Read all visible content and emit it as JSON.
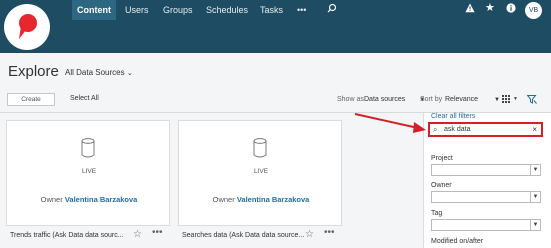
{
  "nav": {
    "items": [
      "Content",
      "Users",
      "Groups",
      "Schedules",
      "Tasks"
    ],
    "more": "•••",
    "avatar_initials": "VB"
  },
  "page": {
    "title": "Explore",
    "source_filter": "All Data Sources"
  },
  "toolbar": {
    "create_label": "Create",
    "select_all_label": "Select All",
    "show_as_label": "Show as",
    "show_as_value": "Data sources",
    "sort_by_label": "Sort by",
    "sort_by_value": "Relevance"
  },
  "cards": [
    {
      "connection": "LIVE",
      "owner_prefix": "Owner",
      "owner": "Valentina Barzakova",
      "name": "Trends traffic (Ask Data data sourc..."
    },
    {
      "connection": "LIVE",
      "owner_prefix": "Owner",
      "owner": "Valentina Barzakova",
      "name": "Searches data (Ask Data data source..."
    }
  ],
  "filters": {
    "clear_all": "Clear all filters",
    "search_value": "ask data",
    "fields": [
      "Project",
      "Owner",
      "Tag",
      "Modified on/after"
    ]
  },
  "colors": {
    "nav_bg": "#1d4c63",
    "accent_link": "#1f6fa3",
    "highlight_red": "#d62027"
  }
}
